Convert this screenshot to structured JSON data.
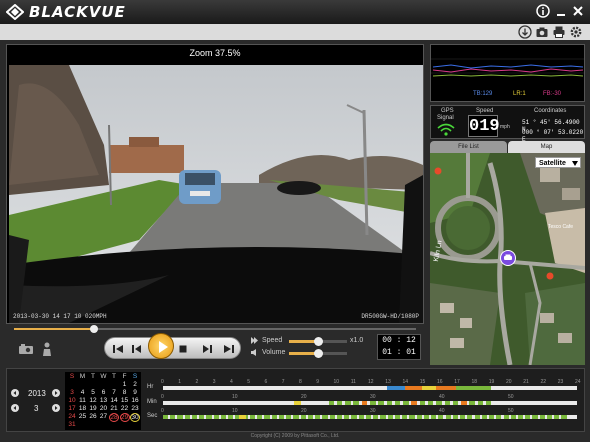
{
  "app": {
    "title": "BLACKVUE"
  },
  "video": {
    "zoom": "Zoom 37.5%",
    "osd_left": "2013-03-30 14 17 10  020MPH",
    "osd_right": "DR500GW-HD/1080P"
  },
  "controls": {
    "seek_progress": 0.2,
    "speed_label": "Speed",
    "speed_value": "x1.0",
    "speed_level": 0.5,
    "volume_label": "Volume",
    "volume_level": 0.5,
    "time_elapsed": "00 : 12",
    "time_total": "01 : 01"
  },
  "graph": {
    "tb": "TB:129",
    "lr": "LR:1",
    "fb": "FB:-30"
  },
  "gps": {
    "signal_label_1": "GPS",
    "signal_label_2": "Signal",
    "speed_label": "Speed",
    "speed_value": "019",
    "speed_unit": "mph",
    "coords_label": "Coordinates",
    "lat": "51 ° 45' 56.4900 N",
    "lon": "000 ° 07' 53.0220 E"
  },
  "tabs": [
    {
      "label": "File List"
    },
    {
      "label": "Map"
    }
  ],
  "map": {
    "type_select": "Satellite",
    "street": "Kiln Ln",
    "poi": "Tesco Cafe"
  },
  "calendar": {
    "year": "2013",
    "month": "3",
    "headers": [
      "S",
      "M",
      "T",
      "W",
      "T",
      "F",
      "S"
    ],
    "rows": [
      [
        "",
        "",
        "",
        "",
        "",
        "1",
        "2"
      ],
      [
        "3",
        "4",
        "5",
        "6",
        "7",
        "8",
        "9"
      ],
      [
        "10",
        "11",
        "12",
        "13",
        "14",
        "15",
        "16"
      ],
      [
        "17",
        "18",
        "19",
        "20",
        "21",
        "22",
        "23"
      ],
      [
        "24",
        "25",
        "26",
        "27",
        "28",
        "29",
        "30"
      ],
      [
        "31",
        "",
        "",
        "",
        "",
        "",
        ""
      ]
    ]
  },
  "timeline": {
    "hr_label": "Hr",
    "min_label": "Min",
    "sec_label": "Sec",
    "hr_ticks": [
      "0",
      "1",
      "2",
      "3",
      "4",
      "5",
      "6",
      "7",
      "8",
      "9",
      "10",
      "11",
      "12",
      "13",
      "14",
      "15",
      "16",
      "17",
      "18",
      "19",
      "20",
      "21",
      "22",
      "23",
      "24"
    ],
    "min_ticks": [
      "0",
      "10",
      "20",
      "30",
      "40",
      "50"
    ],
    "sec_ticks": [
      "0",
      "10",
      "20",
      "30",
      "40",
      "50"
    ]
  },
  "footer": "Copyright (C) 2009 by Pittasoft Co., Ltd.",
  "colors": {
    "accent": "#e8b04a",
    "normal": "#7ab83c",
    "event": "#e87a20",
    "manual": "#3a8ad0"
  }
}
